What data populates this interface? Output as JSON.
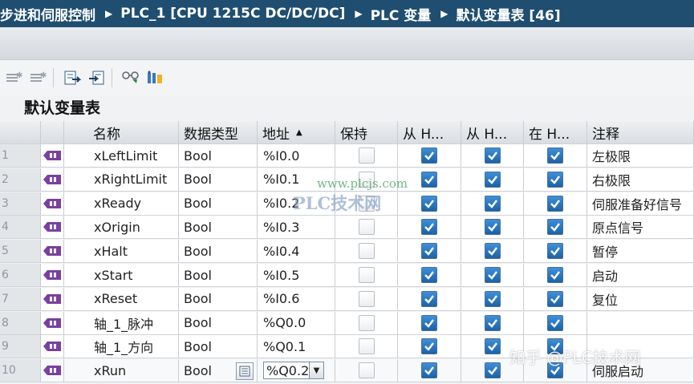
{
  "breadcrumb": {
    "items": [
      "步进和伺服控制",
      "PLC_1 [CPU 1215C DC/DC/DC]",
      "PLC 变量",
      "默认变量表 [46]"
    ]
  },
  "table": {
    "title": "默认变量表",
    "columns": {
      "name": "名称",
      "datatype": "数据类型",
      "address": "地址",
      "retain": "保持",
      "hmi_access": "从 H...",
      "hmi_write": "从 H...",
      "hmi_visible": "在 H...",
      "comment": "注释"
    },
    "sort_icon": "sort-ascending-icon",
    "rows": [
      {
        "num": "1",
        "name": "xLeftLimit",
        "type": "Bool",
        "address": "%I0.0",
        "retain": false,
        "h1": true,
        "h2": true,
        "h3": true,
        "comment": "左极限"
      },
      {
        "num": "2",
        "name": "xRightLimit",
        "type": "Bool",
        "address": "%I0.1",
        "retain": false,
        "h1": true,
        "h2": true,
        "h3": true,
        "comment": "右极限"
      },
      {
        "num": "3",
        "name": "xReady",
        "type": "Bool",
        "address": "%I0.2",
        "retain": false,
        "h1": true,
        "h2": true,
        "h3": true,
        "comment": "伺服准备好信号"
      },
      {
        "num": "4",
        "name": "xOrigin",
        "type": "Bool",
        "address": "%I0.3",
        "retain": false,
        "h1": true,
        "h2": true,
        "h3": true,
        "comment": "原点信号"
      },
      {
        "num": "5",
        "name": "xHalt",
        "type": "Bool",
        "address": "%I0.4",
        "retain": false,
        "h1": true,
        "h2": true,
        "h3": true,
        "comment": "暂停"
      },
      {
        "num": "6",
        "name": "xStart",
        "type": "Bool",
        "address": "%I0.5",
        "retain": false,
        "h1": true,
        "h2": true,
        "h3": true,
        "comment": "启动"
      },
      {
        "num": "7",
        "name": "xReset",
        "type": "Bool",
        "address": "%I0.6",
        "retain": false,
        "h1": true,
        "h2": true,
        "h3": true,
        "comment": "复位"
      },
      {
        "num": "8",
        "name": "轴_1_脉冲",
        "type": "Bool",
        "address": "%Q0.0",
        "retain": false,
        "h1": true,
        "h2": true,
        "h3": true,
        "comment": ""
      },
      {
        "num": "9",
        "name": "轴_1_方向",
        "type": "Bool",
        "address": "%Q0.1",
        "retain": false,
        "h1": true,
        "h2": true,
        "h3": true,
        "comment": ""
      },
      {
        "num": "10",
        "name": "xRun",
        "type": "Bool",
        "address": "%Q0.2",
        "retain": false,
        "h1": true,
        "h2": true,
        "h3": true,
        "comment": "伺服启动"
      }
    ]
  },
  "watermarks": {
    "site": "www.plcjs.com",
    "center": "PLC技术网",
    "corner": "知乎 @PLC技术网"
  },
  "colors": {
    "titlebar": "#1f4e70",
    "checkbox_checked": "#1b62a8",
    "tag_icon": "#7a3fa0"
  }
}
